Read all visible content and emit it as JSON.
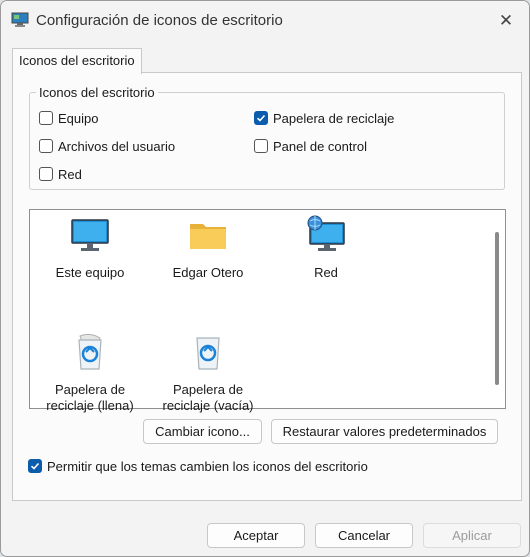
{
  "window": {
    "title": "Configuración de iconos de escritorio"
  },
  "tabs": [
    {
      "label": "Iconos del escritorio"
    }
  ],
  "group": {
    "legend": "Iconos del escritorio",
    "checkboxes": [
      {
        "label": "Equipo",
        "checked": false
      },
      {
        "label": "Papelera de reciclaje",
        "checked": true
      },
      {
        "label": "Archivos del usuario",
        "checked": false
      },
      {
        "label": "Panel de control",
        "checked": false
      },
      {
        "label": "Red",
        "checked": false
      }
    ]
  },
  "icons": [
    {
      "label": "Este equipo",
      "icon": "monitor-icon"
    },
    {
      "label": "Edgar Otero",
      "icon": "folder-icon"
    },
    {
      "label": "Red",
      "icon": "network-icon"
    },
    {
      "label": "Papelera de reciclaje (llena)",
      "icon": "recycle-bin-full-icon"
    },
    {
      "label": "Papelera de reciclaje (vacía)",
      "icon": "recycle-bin-empty-icon"
    }
  ],
  "buttons": {
    "change_icon": "Cambiar icono...",
    "restore_defaults": "Restaurar valores predeterminados"
  },
  "theme_option": {
    "label": "Permitir que los temas cambien los iconos del escritorio",
    "checked": true
  },
  "footer": {
    "accept": "Aceptar",
    "cancel": "Cancelar",
    "apply": "Aplicar"
  },
  "colors": {
    "accent": "#0b5cad"
  }
}
